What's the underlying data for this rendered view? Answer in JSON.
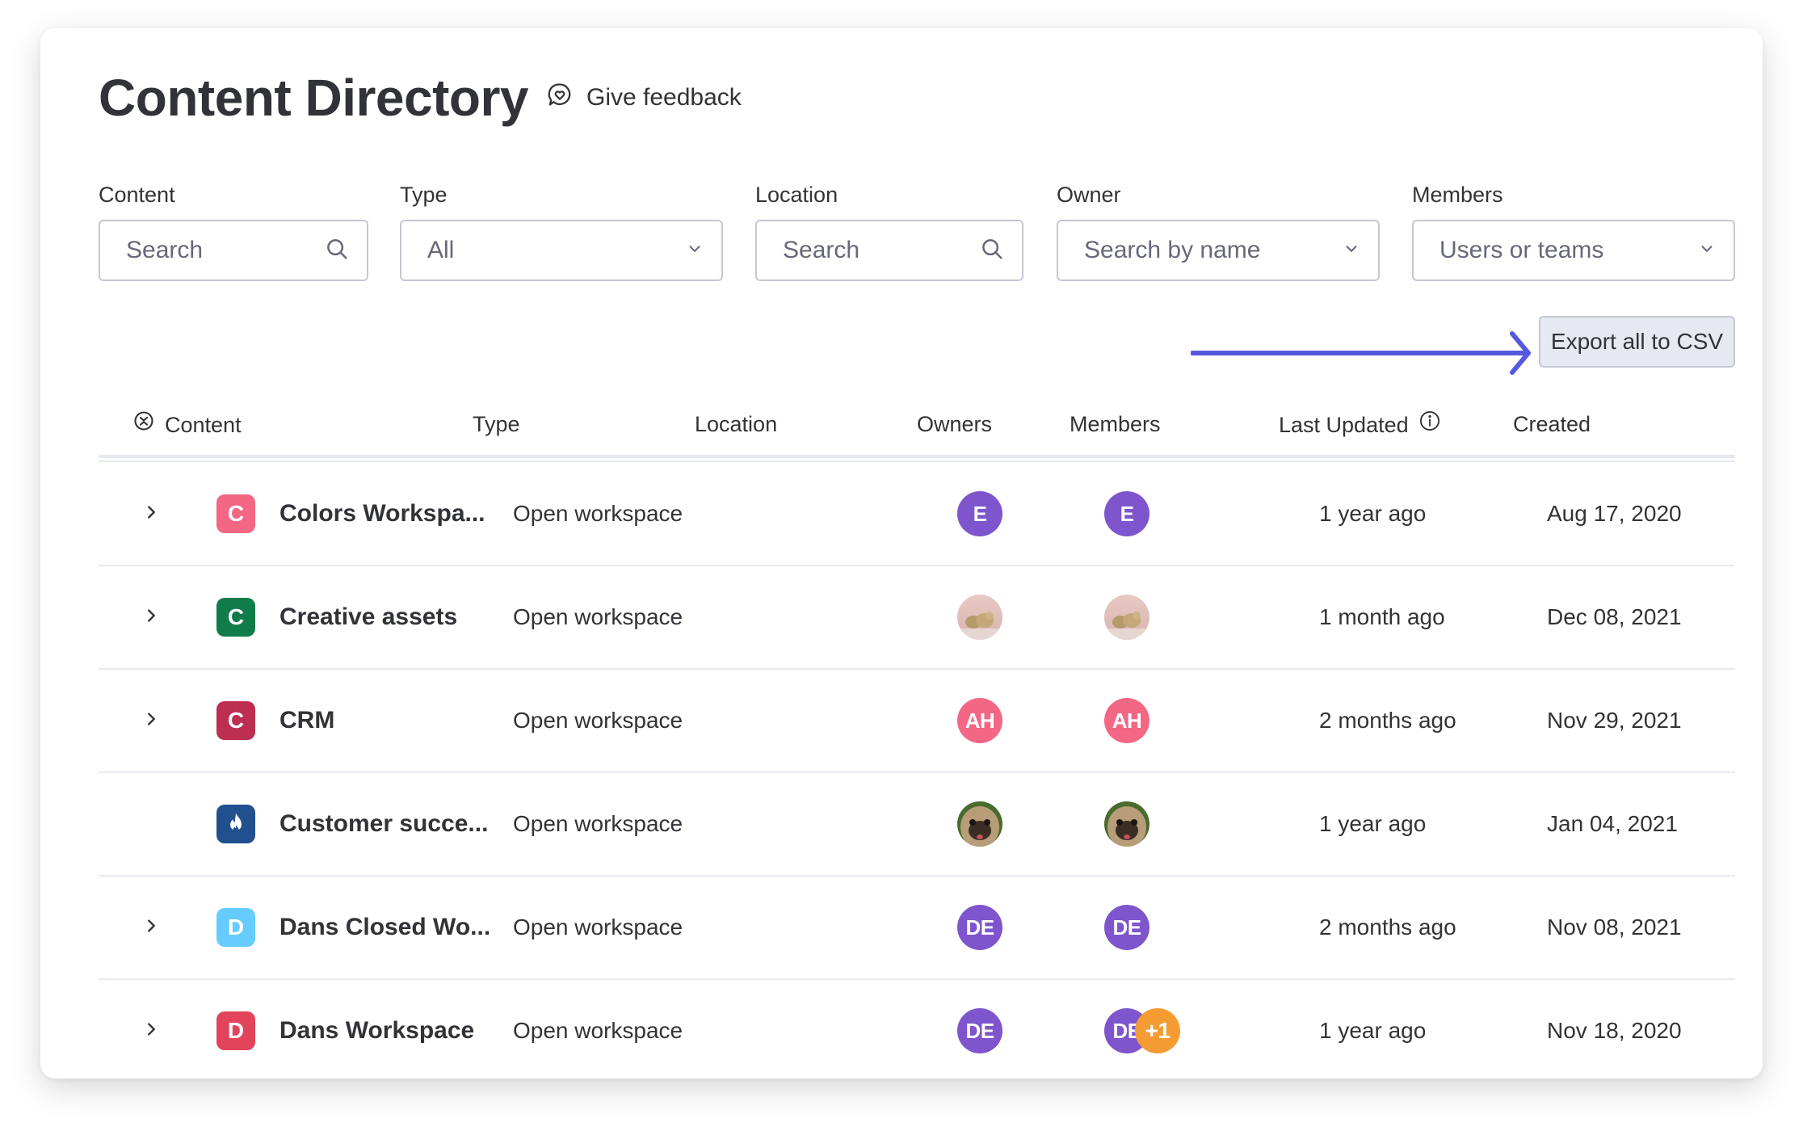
{
  "header": {
    "title": "Content Directory",
    "feedback_label": "Give feedback",
    "feedback_icon": "heart-chat-icon"
  },
  "filters": [
    {
      "label": "Content",
      "kind": "search",
      "placeholder": "Search",
      "icon": "search-icon"
    },
    {
      "label": "Type",
      "kind": "select",
      "value": "All",
      "icon": "chevron-down-icon"
    },
    {
      "label": "Location",
      "kind": "search",
      "placeholder": "Search",
      "icon": "search-icon"
    },
    {
      "label": "Owner",
      "kind": "select",
      "placeholder": "Search by name",
      "icon": "chevron-down-icon"
    },
    {
      "label": "Members",
      "kind": "select",
      "placeholder": "Users or teams",
      "icon": "chevron-down-icon"
    }
  ],
  "export": {
    "label": "Export all to CSV",
    "annotation_arrow_color": "#5559df"
  },
  "table": {
    "columns": {
      "content": "Content",
      "type": "Type",
      "location": "Location",
      "owners": "Owners",
      "members": "Members",
      "last_updated": "Last Updated",
      "created": "Created"
    },
    "rows": [
      {
        "expandable": true,
        "icon": {
          "letter": "C",
          "color": "#f36784"
        },
        "name": "Colors Workspa...",
        "type": "Open workspace",
        "location": "",
        "owner": {
          "initials": "E",
          "color": "#7e55cd"
        },
        "members": [
          {
            "initials": "E",
            "color": "#7e55cd"
          }
        ],
        "last_updated": "1 year ago",
        "created": "Aug 17, 2020"
      },
      {
        "expandable": true,
        "icon": {
          "letter": "C",
          "color": "#0f7c4a"
        },
        "name": "Creative assets",
        "type": "Open workspace",
        "location": "",
        "owner": {
          "photo": "polar-bears"
        },
        "members": [
          {
            "photo": "polar-bears"
          }
        ],
        "last_updated": "1 month ago",
        "created": "Dec 08, 2021"
      },
      {
        "expandable": true,
        "icon": {
          "letter": "C",
          "color": "#bc2f51"
        },
        "name": "CRM",
        "type": "Open workspace",
        "location": "",
        "owner": {
          "initials": "AH",
          "color": "#f36784"
        },
        "members": [
          {
            "initials": "AH",
            "color": "#f36784"
          }
        ],
        "last_updated": "2 months ago",
        "created": "Nov 29, 2021"
      },
      {
        "expandable": false,
        "icon": {
          "symbol": "flame-icon",
          "color": "#21508f"
        },
        "name": "Customer succe...",
        "type": "Open workspace",
        "location": "",
        "owner": {
          "photo": "pug"
        },
        "members": [
          {
            "photo": "pug"
          }
        ],
        "last_updated": "1 year ago",
        "created": "Jan 04, 2021"
      },
      {
        "expandable": true,
        "icon": {
          "letter": "D",
          "color": "#66ccff"
        },
        "name": "Dans Closed Wo...",
        "type": "Open workspace",
        "location": "",
        "owner": {
          "initials": "DE",
          "color": "#7e55cd"
        },
        "members": [
          {
            "initials": "DE",
            "color": "#7e55cd"
          }
        ],
        "last_updated": "2 months ago",
        "created": "Nov 08, 2021"
      },
      {
        "expandable": true,
        "icon": {
          "letter": "D",
          "color": "#e2445c"
        },
        "name": "Dans Workspace",
        "type": "Open workspace",
        "location": "",
        "owner": {
          "initials": "DE",
          "color": "#7e55cd"
        },
        "members": [
          {
            "initials": "DE",
            "color": "#7e55cd"
          },
          {
            "initials": "+1",
            "color": "#f49c32"
          }
        ],
        "last_updated": "1 year ago",
        "created": "Nov 18, 2020"
      }
    ]
  }
}
